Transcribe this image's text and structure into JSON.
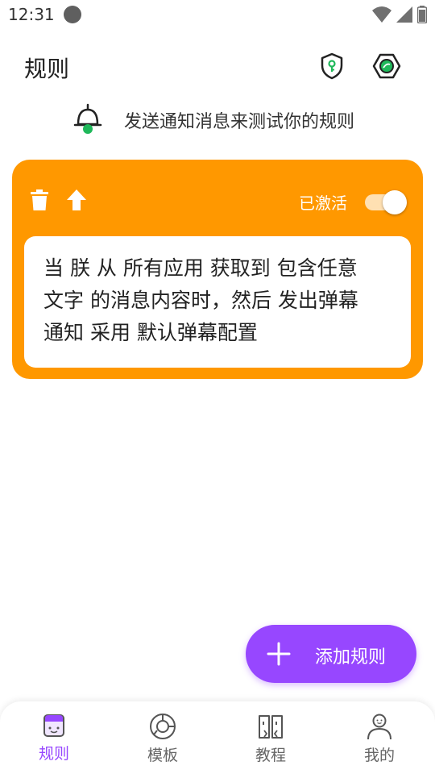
{
  "status_bar": {
    "time": "12:31"
  },
  "app_bar": {
    "title": "规则"
  },
  "test_notice": {
    "text": "发送通知消息来测试你的规则"
  },
  "rule_card": {
    "active_label": "已激活",
    "toggle_on": true,
    "segments": [
      "当",
      "朕",
      "从",
      "所有应用",
      "获取到",
      "包含任意",
      "文字",
      "的消息内容时，然后",
      "发出弹幕",
      "通知",
      "采用",
      "默认弹幕配置"
    ],
    "lines": [
      "当 朕 从 所有应用 获取到 包含任意",
      "文字 的消息内容时，然后 发出弹幕",
      "通知 采用 默认弹幕配置"
    ]
  },
  "fab": {
    "label": "添加规则"
  },
  "bottom_nav": {
    "items": [
      {
        "label": "规则",
        "icon": "rules-icon",
        "active": true
      },
      {
        "label": "模板",
        "icon": "template-icon",
        "active": false
      },
      {
        "label": "教程",
        "icon": "tutorial-icon",
        "active": false
      },
      {
        "label": "我的",
        "icon": "profile-icon",
        "active": false
      }
    ]
  },
  "colors": {
    "card": "#ff9800",
    "accent": "#9747ff",
    "bell_dot": "#1fb85a",
    "shield_key": "#1fb85a"
  }
}
